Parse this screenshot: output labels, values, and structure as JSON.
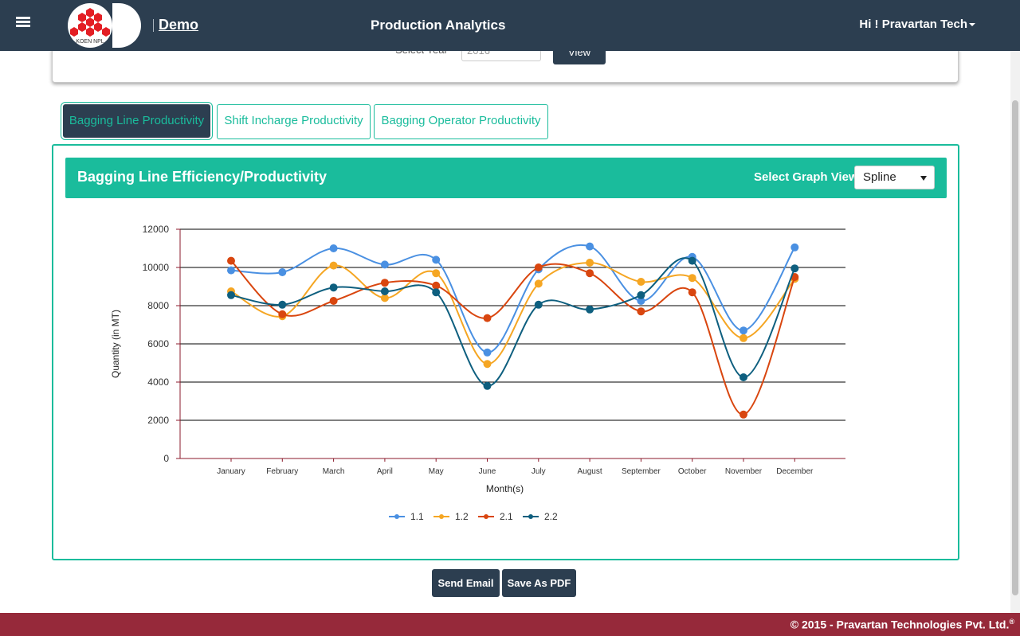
{
  "header": {
    "brand": "Demo",
    "logo_text": "KOEN NPL",
    "title": "Production Analytics",
    "user": "Hi ! Pravartan Tech"
  },
  "filter": {
    "label": "Select Year",
    "value": "2016",
    "button": "View"
  },
  "tabs": [
    {
      "label": "Bagging Line Productivity",
      "active": true
    },
    {
      "label": "Shift Incharge Productivity",
      "active": false
    },
    {
      "label": "Bagging Operator Productivity",
      "active": false
    }
  ],
  "panel": {
    "title": "Bagging Line Efficiency/Productivity",
    "view_label": "Select Graph View:",
    "view_value": "Spline"
  },
  "chart_data": {
    "type": "line",
    "style": "spline",
    "xlabel": "Month(s)",
    "ylabel": "Quantity (in MT)",
    "ylim": [
      0,
      12000
    ],
    "yticks": [
      0,
      2000,
      4000,
      6000,
      8000,
      10000,
      12000
    ],
    "grid": true,
    "legend": "bottom",
    "categories": [
      "January",
      "February",
      "March",
      "April",
      "May",
      "June",
      "July",
      "August",
      "September",
      "October",
      "November",
      "December"
    ],
    "series": [
      {
        "name": "1.1",
        "color": "#4a90e2",
        "values": [
          9850,
          9750,
          11000,
          10150,
          10400,
          5550,
          9900,
          11100,
          8250,
          10550,
          6700,
          11050
        ]
      },
      {
        "name": "1.2",
        "color": "#f5a623",
        "values": [
          8750,
          7450,
          10100,
          8400,
          9700,
          4950,
          9150,
          10250,
          9250,
          9450,
          6300,
          9400
        ]
      },
      {
        "name": "2.1",
        "color": "#d9460f",
        "values": [
          10350,
          7550,
          8250,
          9200,
          9050,
          7350,
          10000,
          9700,
          7700,
          8700,
          2300,
          9500
        ]
      },
      {
        "name": "2.2",
        "color": "#0e5f7f",
        "values": [
          8550,
          8050,
          8950,
          8750,
          8700,
          3800,
          8050,
          7800,
          8550,
          10350,
          4250,
          9950
        ]
      }
    ]
  },
  "buttons": {
    "email": "Send Email",
    "pdf": "Save As PDF"
  },
  "footer": {
    "text": "© 2015 - Pravartan Technologies Pvt. Ltd.",
    "mark": "®"
  }
}
